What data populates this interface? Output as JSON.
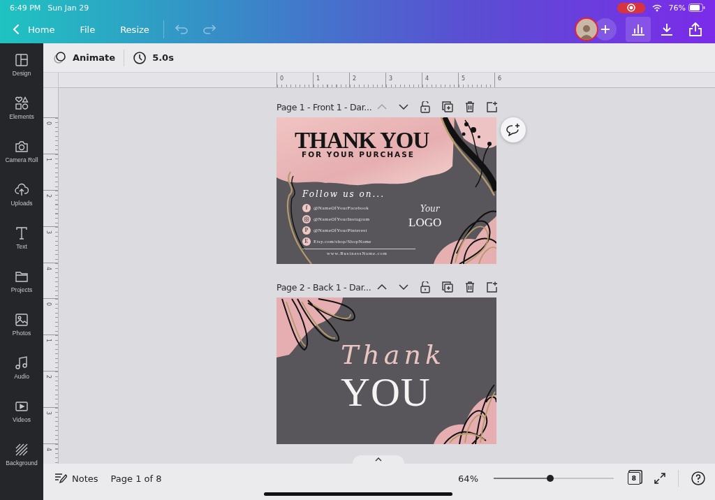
{
  "status_bar": {
    "time": "6:49 PM",
    "date": "Sun Jan 29",
    "battery": "76%"
  },
  "top_bar": {
    "back": "Home",
    "menu": [
      "File",
      "Resize"
    ]
  },
  "toolbar": {
    "animate": "Animate",
    "duration": "5.0s"
  },
  "sidebar": {
    "items": [
      {
        "label": "Design",
        "kind": "design"
      },
      {
        "label": "Elements",
        "kind": "elements"
      },
      {
        "label": "Camera Roll",
        "kind": "camera"
      },
      {
        "label": "Uploads",
        "kind": "uploads"
      },
      {
        "label": "Text",
        "kind": "text"
      },
      {
        "label": "Projects",
        "kind": "projects"
      },
      {
        "label": "Photos",
        "kind": "photos"
      },
      {
        "label": "Audio",
        "kind": "audio"
      },
      {
        "label": "Videos",
        "kind": "videos"
      },
      {
        "label": "Background",
        "kind": "background"
      }
    ]
  },
  "rulers": {
    "horizontal": [
      "0",
      "1",
      "2",
      "3",
      "4",
      "5",
      "6"
    ],
    "vertical": [
      [
        "0",
        "1",
        "2",
        "3",
        "4"
      ],
      [
        "0",
        "1",
        "2",
        "3",
        "4"
      ]
    ]
  },
  "pages": [
    {
      "title": "Page 1 - Front 1 - Dar...",
      "kind": "front",
      "headline": "THANK YOU",
      "subheadline": "FOR YOUR PURCHASE",
      "follow": "Follow us on...",
      "socials": [
        {
          "kind": "letter",
          "glyph": "f",
          "handle": "@NameOfYourFacebook"
        },
        {
          "kind": "camera",
          "handle": "@NameOfYourInstagram"
        },
        {
          "kind": "letter",
          "glyph": "P",
          "handle": "@NameOfYourPinterest"
        },
        {
          "kind": "letter",
          "glyph": "E",
          "handle": "Etsy.com/shop/ShopName"
        }
      ],
      "website": "www.BusinessName.com",
      "logo_script": "Your",
      "logo": "LOGO",
      "move_up_disabled": true
    },
    {
      "title": "Page 2 - Back 1 - Dar...",
      "kind": "back",
      "script": "Thank",
      "headline": "YOU",
      "move_up_disabled": false
    }
  ],
  "bottom_bar": {
    "notes": "Notes",
    "page_indicator": "Page 1 of 8",
    "zoom": "64%",
    "zoom_slider": {
      "level": 0.47
    },
    "page_count": "8"
  }
}
